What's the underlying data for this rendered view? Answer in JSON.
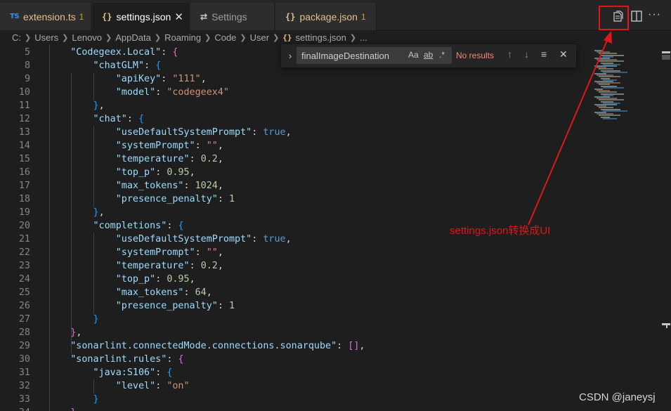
{
  "tabs": [
    {
      "icon": "TS",
      "label": "extension.ts",
      "badge": "1"
    },
    {
      "icon": "{}",
      "label": "settings.json",
      "close": "✕"
    },
    {
      "icon": "⇄",
      "label": "Settings"
    },
    {
      "icon": "{}",
      "label": "package.json",
      "badge": "1"
    }
  ],
  "editor_actions": {
    "more": "···"
  },
  "breadcrumb": [
    "C:",
    "Users",
    "Lenovo",
    "AppData",
    "Roaming",
    "Code",
    "User",
    "settings.json",
    "..."
  ],
  "breadcrumb_file_icon": "{}",
  "find_widget": {
    "toggle": "›",
    "query": "finalImageDestination",
    "match_case": "Aa",
    "match_word": "ab",
    "regex": ".*",
    "status": "No results",
    "prev": "↑",
    "next": "↓",
    "in_selection": "≡",
    "close": "✕"
  },
  "code_lines": [
    {
      "n": "5",
      "tokens": [
        [
          "p",
          "    "
        ],
        [
          "k",
          "\"Codegeex.Local\""
        ],
        [
          "p",
          ": "
        ],
        [
          "br2",
          "{"
        ]
      ]
    },
    {
      "n": "8",
      "tokens": [
        [
          "p",
          "        "
        ],
        [
          "k",
          "\"chatGLM\""
        ],
        [
          "p",
          ": "
        ],
        [
          "br3",
          "{"
        ]
      ]
    },
    {
      "n": "9",
      "tokens": [
        [
          "p",
          "            "
        ],
        [
          "k",
          "\"apiKey\""
        ],
        [
          "p",
          ": "
        ],
        [
          "s",
          "\"111\""
        ],
        [
          "p",
          ","
        ]
      ]
    },
    {
      "n": "10",
      "tokens": [
        [
          "p",
          "            "
        ],
        [
          "k",
          "\"model\""
        ],
        [
          "p",
          ": "
        ],
        [
          "s",
          "\"codegeex4\""
        ]
      ]
    },
    {
      "n": "11",
      "tokens": [
        [
          "p",
          "        "
        ],
        [
          "br3",
          "}"
        ],
        [
          "p",
          ","
        ]
      ]
    },
    {
      "n": "12",
      "tokens": [
        [
          "p",
          "        "
        ],
        [
          "k",
          "\"chat\""
        ],
        [
          "p",
          ": "
        ],
        [
          "br3",
          "{"
        ]
      ]
    },
    {
      "n": "13",
      "tokens": [
        [
          "p",
          "            "
        ],
        [
          "k",
          "\"useDefaultSystemPrompt\""
        ],
        [
          "p",
          ": "
        ],
        [
          "b",
          "true"
        ],
        [
          "p",
          ","
        ]
      ]
    },
    {
      "n": "14",
      "tokens": [
        [
          "p",
          "            "
        ],
        [
          "k",
          "\"systemPrompt\""
        ],
        [
          "p",
          ": "
        ],
        [
          "s",
          "\"\""
        ],
        [
          "p",
          ","
        ]
      ]
    },
    {
      "n": "15",
      "tokens": [
        [
          "p",
          "            "
        ],
        [
          "k",
          "\"temperature\""
        ],
        [
          "p",
          ": "
        ],
        [
          "n",
          "0.2"
        ],
        [
          "p",
          ","
        ]
      ]
    },
    {
      "n": "16",
      "tokens": [
        [
          "p",
          "            "
        ],
        [
          "k",
          "\"top_p\""
        ],
        [
          "p",
          ": "
        ],
        [
          "n",
          "0.95"
        ],
        [
          "p",
          ","
        ]
      ]
    },
    {
      "n": "17",
      "tokens": [
        [
          "p",
          "            "
        ],
        [
          "k",
          "\"max_tokens\""
        ],
        [
          "p",
          ": "
        ],
        [
          "n",
          "1024"
        ],
        [
          "p",
          ","
        ]
      ]
    },
    {
      "n": "18",
      "tokens": [
        [
          "p",
          "            "
        ],
        [
          "k",
          "\"presence_penalty\""
        ],
        [
          "p",
          ": "
        ],
        [
          "n",
          "1"
        ]
      ]
    },
    {
      "n": "19",
      "tokens": [
        [
          "p",
          "        "
        ],
        [
          "br3",
          "}"
        ],
        [
          "p",
          ","
        ]
      ]
    },
    {
      "n": "20",
      "tokens": [
        [
          "p",
          "        "
        ],
        [
          "k",
          "\"completions\""
        ],
        [
          "p",
          ": "
        ],
        [
          "br3",
          "{"
        ]
      ]
    },
    {
      "n": "21",
      "tokens": [
        [
          "p",
          "            "
        ],
        [
          "k",
          "\"useDefaultSystemPrompt\""
        ],
        [
          "p",
          ": "
        ],
        [
          "b",
          "true"
        ],
        [
          "p",
          ","
        ]
      ]
    },
    {
      "n": "22",
      "tokens": [
        [
          "p",
          "            "
        ],
        [
          "k",
          "\"systemPrompt\""
        ],
        [
          "p",
          ": "
        ],
        [
          "s",
          "\"\""
        ],
        [
          "p",
          ","
        ]
      ]
    },
    {
      "n": "23",
      "tokens": [
        [
          "p",
          "            "
        ],
        [
          "k",
          "\"temperature\""
        ],
        [
          "p",
          ": "
        ],
        [
          "n",
          "0.2"
        ],
        [
          "p",
          ","
        ]
      ]
    },
    {
      "n": "24",
      "tokens": [
        [
          "p",
          "            "
        ],
        [
          "k",
          "\"top_p\""
        ],
        [
          "p",
          ": "
        ],
        [
          "n",
          "0.95"
        ],
        [
          "p",
          ","
        ]
      ]
    },
    {
      "n": "25",
      "tokens": [
        [
          "p",
          "            "
        ],
        [
          "k",
          "\"max_tokens\""
        ],
        [
          "p",
          ": "
        ],
        [
          "n",
          "64"
        ],
        [
          "p",
          ","
        ]
      ]
    },
    {
      "n": "26",
      "tokens": [
        [
          "p",
          "            "
        ],
        [
          "k",
          "\"presence_penalty\""
        ],
        [
          "p",
          ": "
        ],
        [
          "n",
          "1"
        ]
      ]
    },
    {
      "n": "27",
      "tokens": [
        [
          "p",
          "        "
        ],
        [
          "br3",
          "}"
        ]
      ]
    },
    {
      "n": "28",
      "tokens": [
        [
          "p",
          "    "
        ],
        [
          "br2",
          "}"
        ],
        [
          "p",
          ","
        ]
      ]
    },
    {
      "n": "29",
      "tokens": [
        [
          "p",
          "    "
        ],
        [
          "k",
          "\"sonarlint.connectedMode.connections.sonarqube\""
        ],
        [
          "p",
          ": "
        ],
        [
          "br2",
          "[]"
        ],
        [
          "p",
          ","
        ]
      ]
    },
    {
      "n": "30",
      "tokens": [
        [
          "p",
          "    "
        ],
        [
          "k",
          "\"sonarlint.rules\""
        ],
        [
          "p",
          ": "
        ],
        [
          "br2",
          "{"
        ]
      ]
    },
    {
      "n": "31",
      "tokens": [
        [
          "p",
          "        "
        ],
        [
          "k",
          "\"java:S106\""
        ],
        [
          "p",
          ": "
        ],
        [
          "br3",
          "{"
        ]
      ]
    },
    {
      "n": "32",
      "tokens": [
        [
          "p",
          "            "
        ],
        [
          "k",
          "\"level\""
        ],
        [
          "p",
          ": "
        ],
        [
          "s",
          "\"on\""
        ]
      ]
    },
    {
      "n": "33",
      "tokens": [
        [
          "p",
          "        "
        ],
        [
          "br3",
          "}"
        ]
      ]
    },
    {
      "n": "34",
      "tokens": [
        [
          "p",
          "    "
        ],
        [
          "br2",
          "}"
        ]
      ]
    }
  ],
  "annotation": "settings.json转换成UI",
  "watermark": "CSDN @janeysj",
  "colors": {
    "annotation_red": "#e0161b",
    "key": "#9cdcfe",
    "string": "#ce9178",
    "number": "#b5cea8",
    "boolean": "#569cd6"
  }
}
